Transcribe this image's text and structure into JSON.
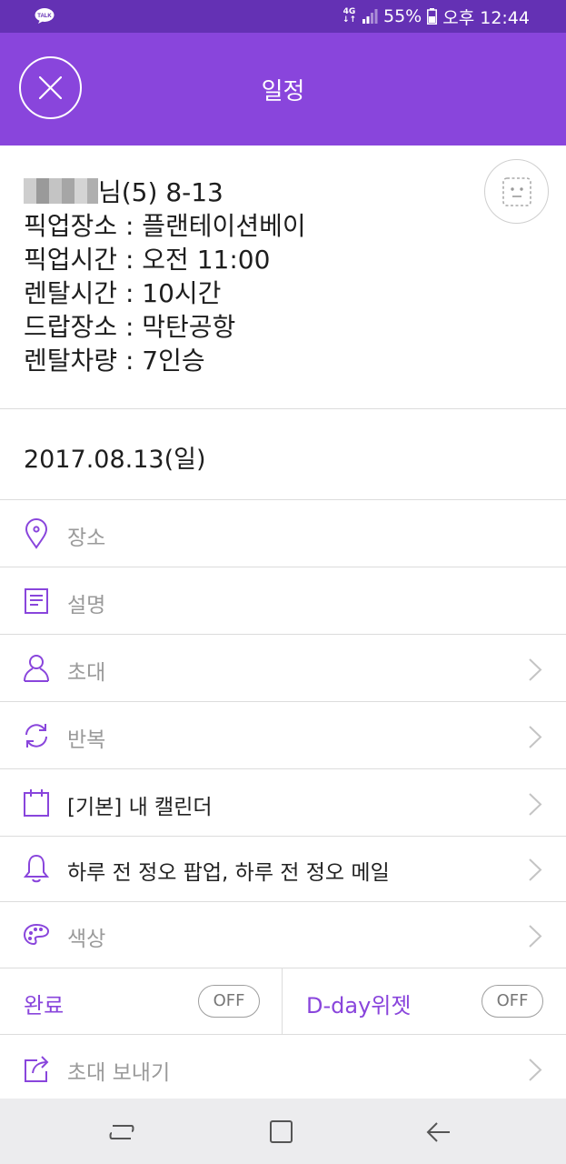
{
  "status_bar": {
    "network_top": "4G",
    "network_arrows": "↓↑",
    "battery": "55%",
    "time": "오후 12:44",
    "app_badge": "TALK"
  },
  "header": {
    "title": "일정"
  },
  "event": {
    "name_suffix": "님(5) 8-13",
    "lines": [
      "픽업장소 : 플랜테이션베이",
      "픽업시간 : 오전 11:00",
      "렌탈시간 : 10시간",
      "드랍장소 : 막탄공항",
      "렌탈차량 : 7인승"
    ]
  },
  "date": "2017.08.13(일)",
  "rows": {
    "location": {
      "label": "장소",
      "icon": "location-pin-icon"
    },
    "description": {
      "label": "설명",
      "icon": "document-icon"
    },
    "invite": {
      "label": "초대",
      "icon": "person-icon"
    },
    "repeat": {
      "label": "반복",
      "icon": "repeat-icon"
    },
    "calendar": {
      "label": "[기본] 내 캘린더",
      "icon": "calendar-icon"
    },
    "alarm": {
      "label": "하루 전 정오 팝업, 하루 전 정오 메일",
      "icon": "bell-icon"
    },
    "color": {
      "label": "색상",
      "icon": "palette-icon"
    },
    "send_invite": {
      "label": "초대 보내기",
      "icon": "share-icon"
    }
  },
  "toggles": {
    "done": {
      "label": "완료",
      "state": "OFF"
    },
    "dday": {
      "label": "D-day위젯",
      "state": "OFF"
    }
  },
  "colors": {
    "status_bar": "#6431b4",
    "header": "#8945dc",
    "accent": "#8945dc",
    "divider": "#dcdcdc",
    "nav_bar": "#ececee"
  }
}
